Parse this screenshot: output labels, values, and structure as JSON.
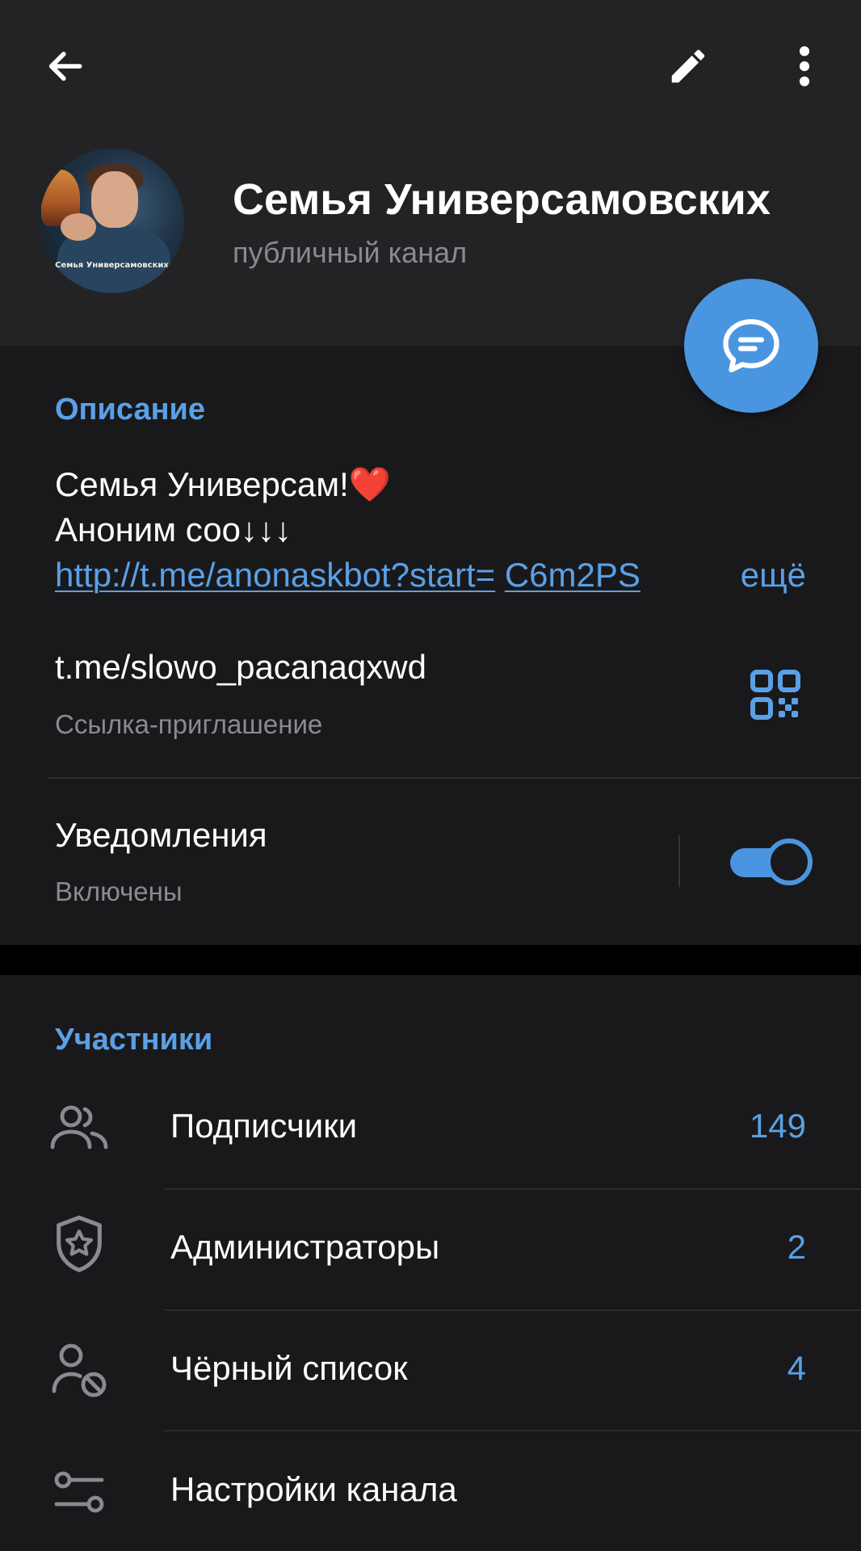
{
  "colors": {
    "header_bg": "#232325",
    "section_bg": "#19191b",
    "separator_bg": "#000000",
    "accent": "#4a95e0",
    "accent_text": "#5aa0e6",
    "secondary_text": "#8a8a8f"
  },
  "toolbar": {
    "back_icon": "arrow-left-icon",
    "edit_icon": "pencil-icon",
    "more_icon": "more-vertical-icon"
  },
  "profile": {
    "avatar_caption": "Семья Универсамовских",
    "title": "Семья Универсамовских",
    "subtitle": "публичный канал",
    "fab_icon": "message-icon"
  },
  "description": {
    "header": "Описание",
    "line1": "Семья Универсам!❤️",
    "line2": "Аноним соо↓↓↓",
    "link": "http://t.me/anonaskbot?start=",
    "link_tail": "C6m2PS",
    "more": "ещё"
  },
  "invite": {
    "link": "t.me/slowo_pacanaqxwd",
    "caption": "Ссылка-приглашение",
    "qr_icon": "qr-code-icon"
  },
  "notifications": {
    "label": "Уведомления",
    "status": "Включены",
    "enabled": true
  },
  "members": {
    "header": "Участники",
    "items": [
      {
        "icon": "users-icon",
        "label": "Подписчики",
        "value": "149"
      },
      {
        "icon": "shield-star-icon",
        "label": "Администраторы",
        "value": "2"
      },
      {
        "icon": "user-block-icon",
        "label": "Чёрный список",
        "value": "4"
      },
      {
        "icon": "sliders-icon",
        "label": "Настройки канала",
        "value": ""
      }
    ]
  }
}
